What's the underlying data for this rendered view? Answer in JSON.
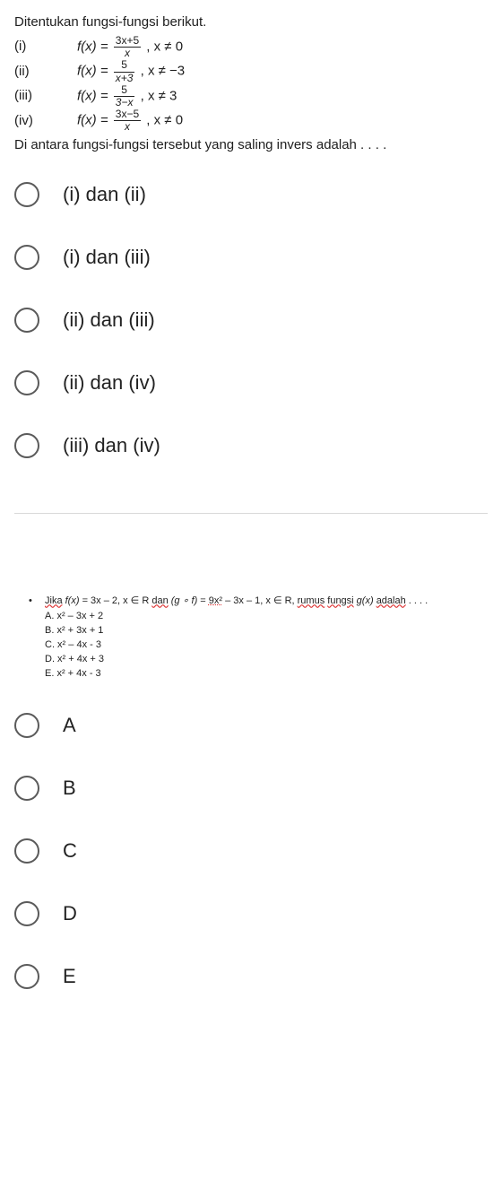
{
  "q1": {
    "intro": "Ditentukan fungsi-fungsi berikut.",
    "statements": [
      {
        "label": "(i)",
        "prefix": "f(x) = ",
        "num": "3x+5",
        "den": "x",
        "tail": " , x ≠ 0"
      },
      {
        "label": "(ii)",
        "prefix": "f(x) = ",
        "num": "5",
        "den": "x+3",
        "tail": " , x ≠ −3"
      },
      {
        "label": "(iii)",
        "prefix": "f(x) = ",
        "num": "5",
        "den": "3−x",
        "tail": " , x ≠ 3"
      },
      {
        "label": "(iv)",
        "prefix": "f(x) = ",
        "num": "3x−5",
        "den": "x",
        "tail": " , x ≠ 0"
      }
    ],
    "trail": "Di antara fungsi-fungsi tersebut yang saling invers adalah . . . .",
    "options": [
      "(i) dan (ii)",
      "(i) dan (iii)",
      "(ii) dan (iii)",
      "(ii) dan (iv)",
      "(iii) dan (iv)"
    ]
  },
  "q2": {
    "stem_parts": {
      "p1": "Jika",
      "p2": " f(x)",
      "p3": " = 3x – 2, x ∈ R ",
      "p4": "dan",
      "p5": " (g ∘ f)",
      "p6": " = ",
      "p7": "9x²",
      "p8": " – 3x – 1, x ∈ R, ",
      "p9": "rumus",
      "p10": " ",
      "p11": "fungsi",
      "p12": " g(x) ",
      "p13": "adalah",
      "p14": " . . . ."
    },
    "sub": [
      "A.  x² – 3x + 2",
      "B.  x² + 3x + 1",
      "C.  x² – 4x - 3",
      "D.  x² + 4x + 3",
      "E.  x² + 4x - 3"
    ],
    "options": [
      "A",
      "B",
      "C",
      "D",
      "E"
    ]
  }
}
